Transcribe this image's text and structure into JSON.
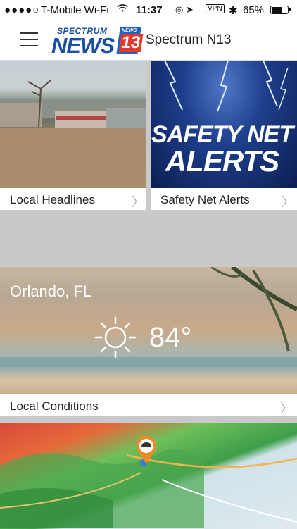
{
  "status_bar": {
    "signal": "●●●●○",
    "carrier": "T-Mobile Wi-Fi",
    "wifi_icon": "wifi-icon",
    "time": "11:37",
    "icons": "◎ ➤",
    "vpn": "VPN",
    "bluetooth": "✱",
    "battery_pct": "65%",
    "battery_level": 0.65
  },
  "header": {
    "logo_top": "SPECTRUM",
    "logo_main": "NEWS",
    "logo_badge_top": "NEWS",
    "logo_badge_num": "13",
    "title": "Spectrum N13"
  },
  "tiles": {
    "local_headlines": "Local Headlines",
    "safety_alerts": "Safety Net Alerts",
    "safety_image_line1": "SAFETY NET",
    "safety_image_line2": "ALERTS",
    "chevron": "〉"
  },
  "weather": {
    "city": "Orlando, FL",
    "temp": "84°",
    "label": "Local Conditions"
  },
  "colors": {
    "brand_blue": "#1b4fa0",
    "badge_red": "#e23a2b"
  }
}
